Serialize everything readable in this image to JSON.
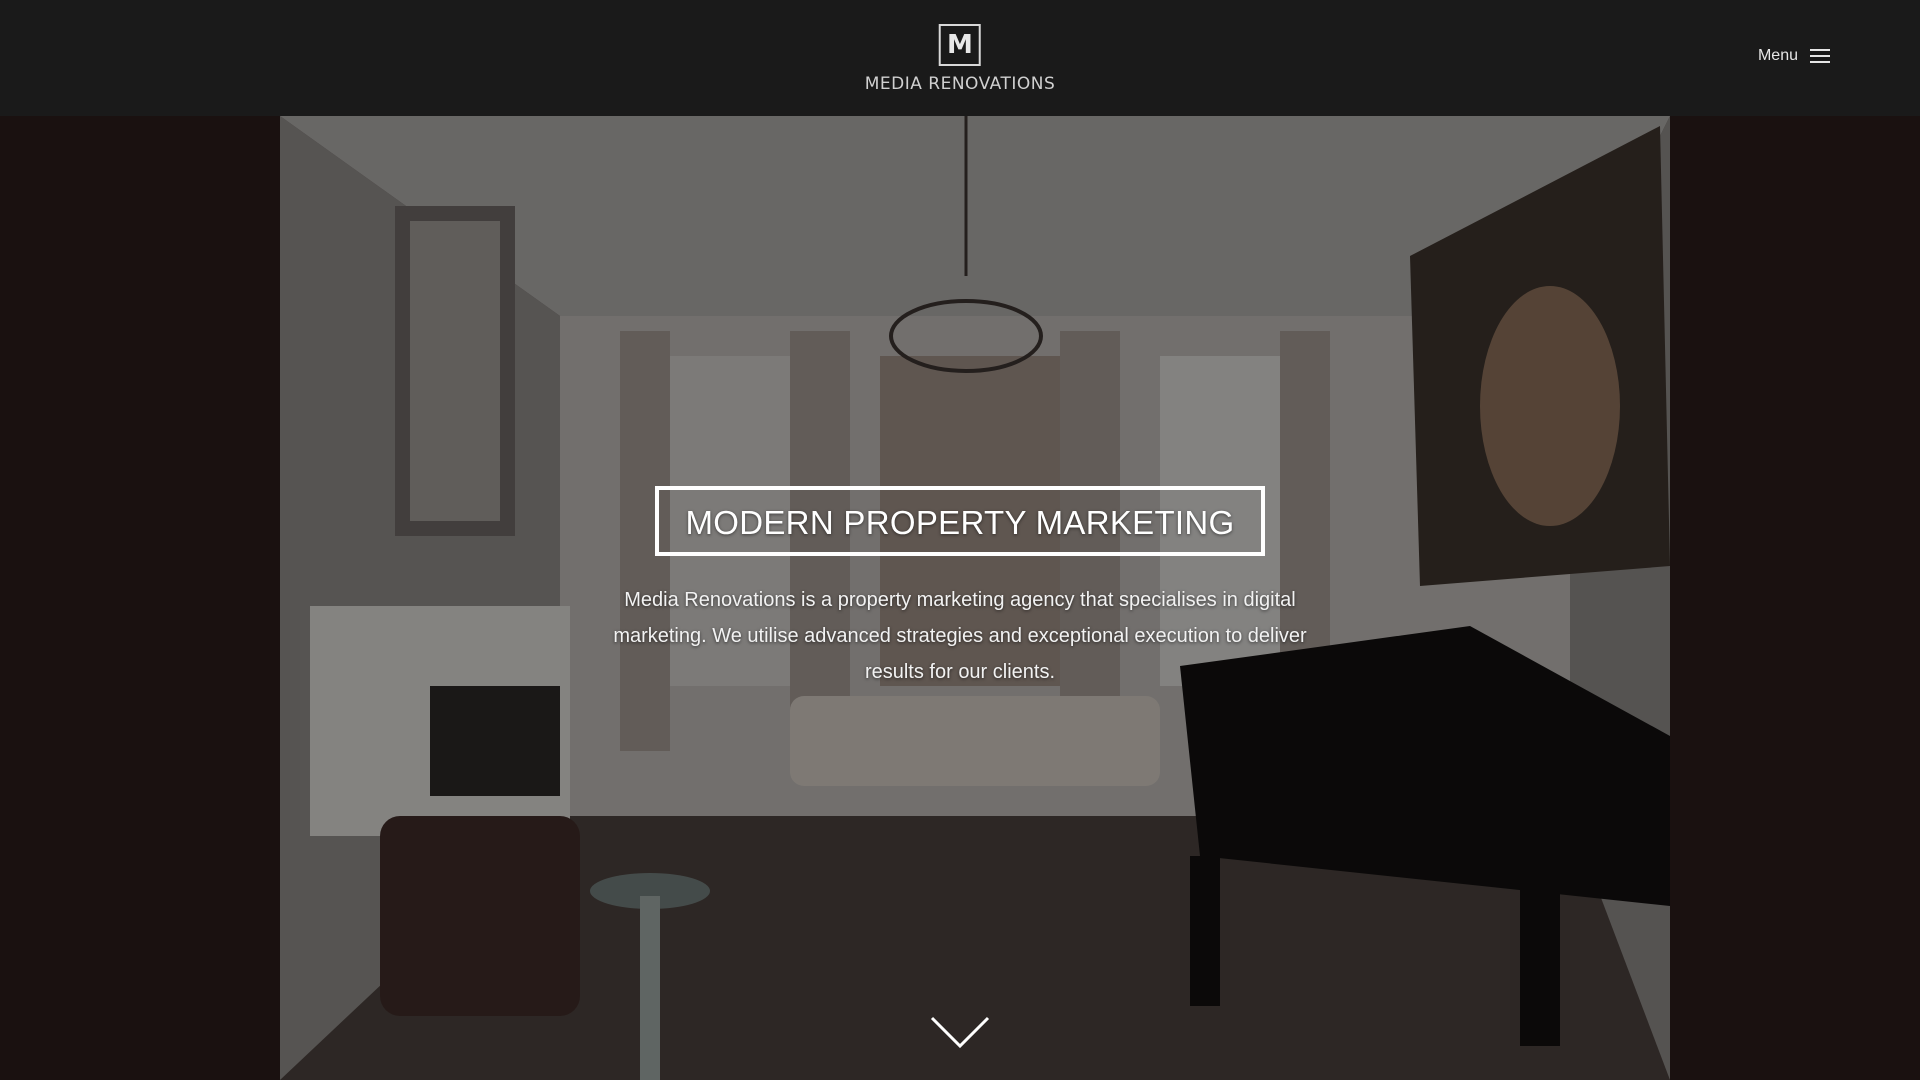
{
  "header": {
    "logo_mark": "M",
    "logo_text": "MEDIA RENOVATIONS",
    "menu_label": "Menu"
  },
  "hero": {
    "title": "MODERN PROPERTY MARKETING",
    "description": "Media Renovations is a property marketing agency that specialises in digital marketing. We utilise advanced strategies and exceptional execution to deliver results for our clients.",
    "background_image": "living-room-photo",
    "scroll_icon": "chevron-down-icon"
  },
  "colors": {
    "header_bg": "#1a1a1a",
    "text_light": "#ffffff"
  }
}
